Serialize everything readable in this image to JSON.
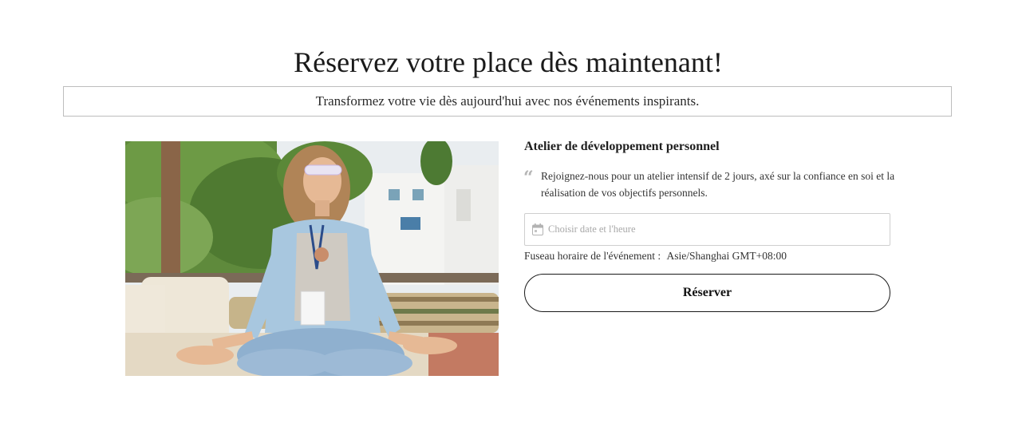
{
  "header": {
    "title": "Réservez votre place dès maintenant!",
    "subtitle": "Transformez votre vie dès aujourd'hui avec nos événements inspirants."
  },
  "event": {
    "name": "Atelier de développement personnel",
    "description": "Rejoignez-nous pour un atelier intensif de 2 jours, axé sur la confiance en soi et la réalisation de vos objectifs personnels.",
    "image_icon": "meditation-photo"
  },
  "booking": {
    "date_placeholder": "Choisir date et l'heure",
    "timezone_label": "Fuseau horaire de l'événement :",
    "timezone_value": "Asie/Shanghai GMT+08:00",
    "reserve_label": "Réserver"
  },
  "colors": {
    "text": "#1f1f1f",
    "border": "#bdbdbd",
    "placeholder": "#a8a8a8"
  }
}
